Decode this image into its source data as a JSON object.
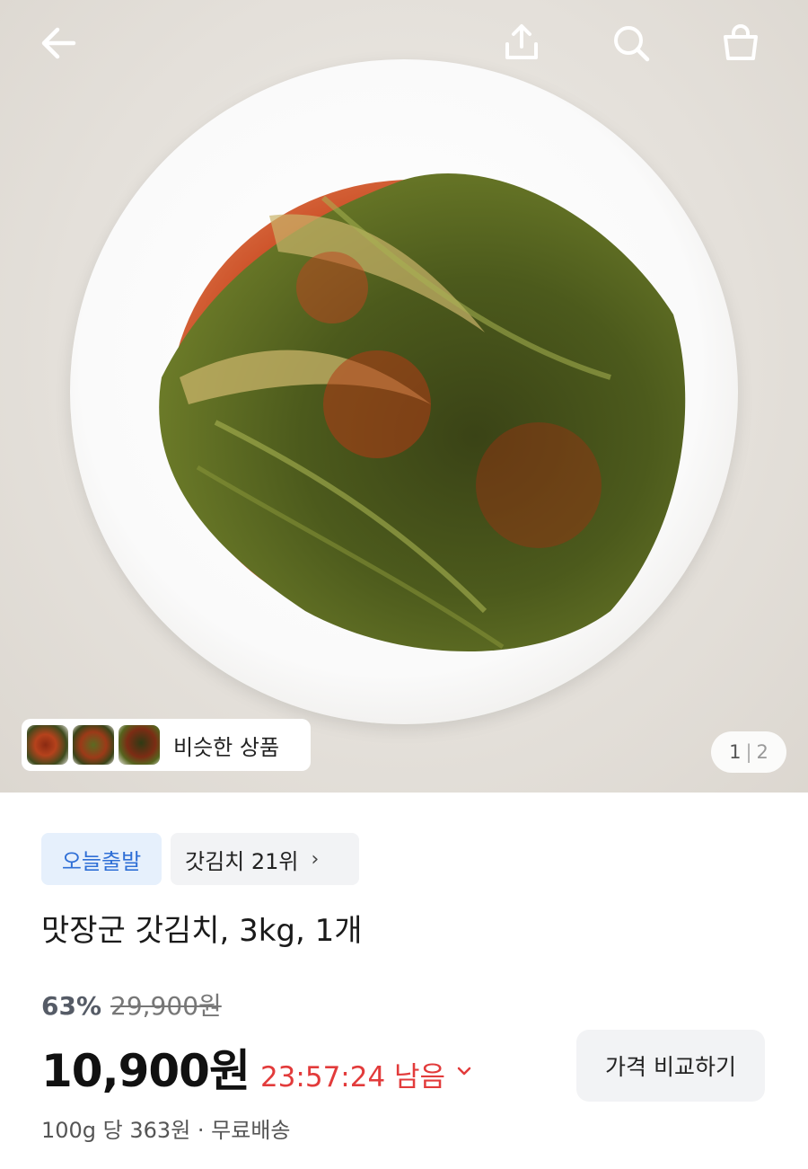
{
  "topbar": {
    "back_icon": "arrow-left-icon",
    "share_icon": "share-icon",
    "search_icon": "search-icon",
    "cart_icon": "shopping-bag-icon"
  },
  "gallery": {
    "similar_label": "비슷한 상품",
    "current_page": "1",
    "page_separator": "|",
    "total_pages": "2"
  },
  "badges": {
    "today_departure": "오늘출발",
    "rank_label": "갓김치 21위",
    "rank_chevron": "›"
  },
  "product": {
    "title": "맛장군 갓김치, 3kg, 1개",
    "discount": "63%",
    "original_price": "29,900원",
    "price": "10,900원",
    "timer": "23:57:24 남음",
    "compare_button": "가격 비교하기",
    "unit_price": "100g 당 363원 · 무료배송"
  },
  "colors": {
    "accent_blue": "#2f6fd6",
    "timer_red": "#e23b3b"
  }
}
